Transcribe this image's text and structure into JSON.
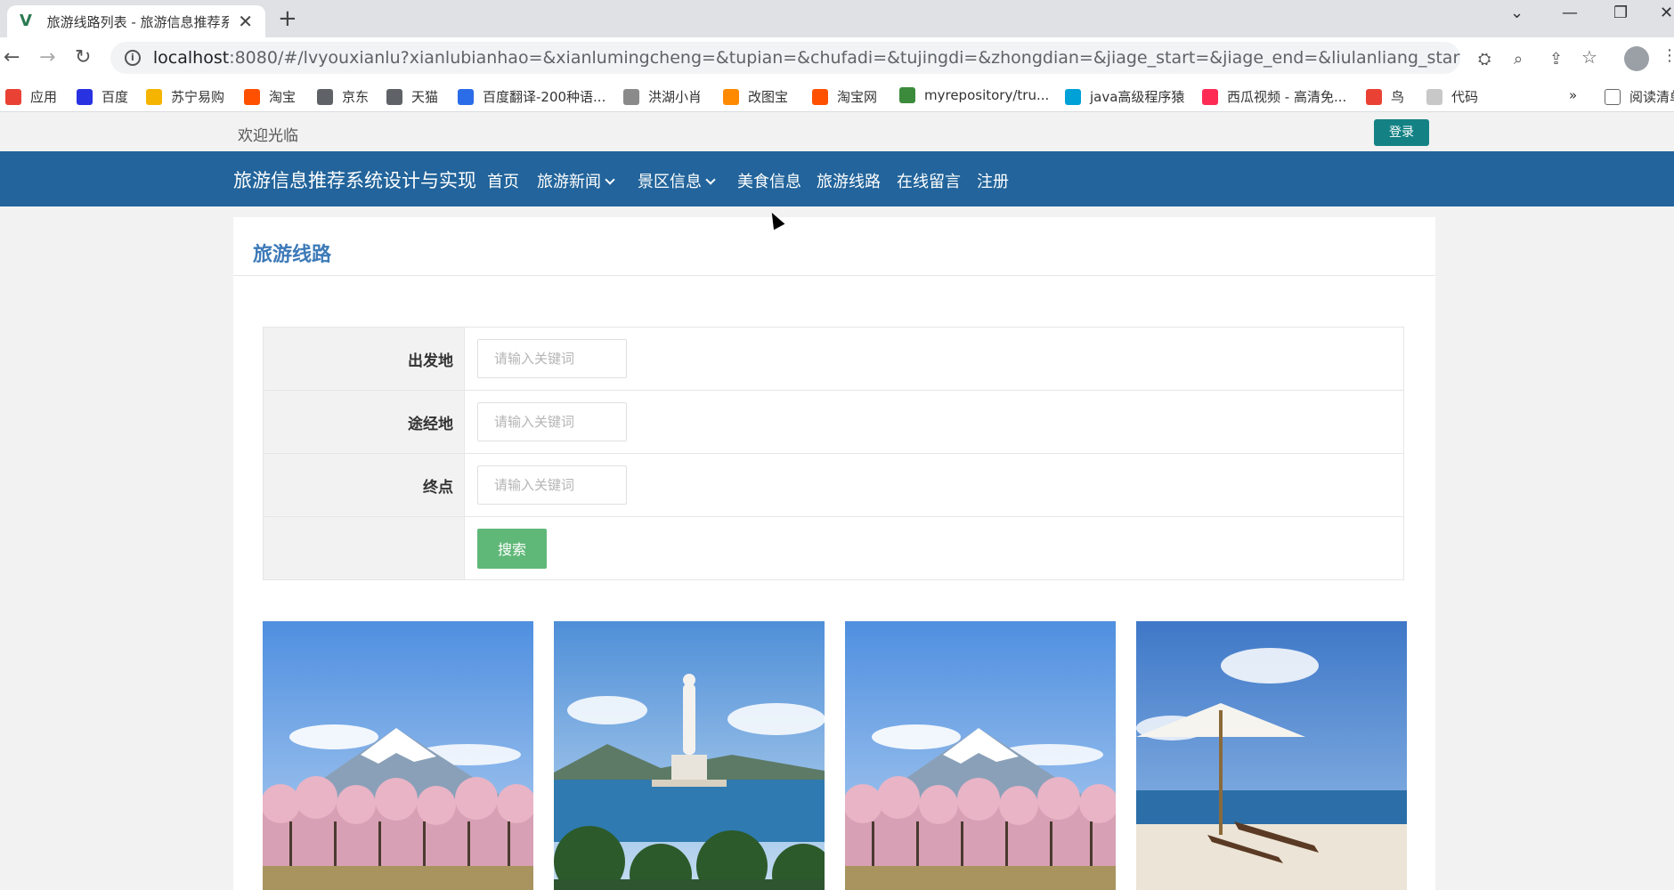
{
  "browser": {
    "tab_title": "旅游线路列表 - 旅游信息推荐系统",
    "tab_favicon": "V",
    "url_host": "localhost",
    "url_rest": ":8080/#/lvyouxianlu?xianlubianhao=&xianlumingcheng=&tupian=&chufadi=&tujingdi=&zhongdian=&jiage_start=&jiage_end=&liulanliang_start=&liulanliang_end...",
    "bookmarks": [
      {
        "label": "应用",
        "color": "#e94235"
      },
      {
        "label": "百度",
        "color": "#2932e1"
      },
      {
        "label": "苏宁易购",
        "color": "#f5b400"
      },
      {
        "label": "淘宝",
        "color": "#ff5000"
      },
      {
        "label": "京东",
        "color": "#5f6368"
      },
      {
        "label": "天猫",
        "color": "#5f6368"
      },
      {
        "label": "百度翻译-200种语...",
        "color": "#2b6de8"
      },
      {
        "label": "洪湖小肖",
        "color": "#8a8a8a"
      },
      {
        "label": "改图宝",
        "color": "#ff8a00"
      },
      {
        "label": "淘宝网",
        "color": "#ff5000"
      },
      {
        "label": "myrepository/tru...",
        "color": "#3c8b3c"
      },
      {
        "label": "java高级程序猿",
        "color": "#00a1d6"
      },
      {
        "label": "西瓜视频 - 高清免...",
        "color": "#fe2c55"
      },
      {
        "label": "鸟",
        "color": "#e94235"
      },
      {
        "label": "代码",
        "color": "#c8c8c8"
      }
    ],
    "bookmarks_overflow": "»",
    "reading_list": "阅读清单"
  },
  "site": {
    "welcome": "欢迎光临",
    "login_label": "登录",
    "brand": "旅游信息推荐系统设计与实现",
    "nav": [
      {
        "label": "首页",
        "dropdown": false
      },
      {
        "label": "旅游新闻",
        "dropdown": true
      },
      {
        "label": "景区信息",
        "dropdown": true
      },
      {
        "label": "美食信息",
        "dropdown": false
      },
      {
        "label": "旅游线路",
        "dropdown": false
      },
      {
        "label": "在线留言",
        "dropdown": false
      },
      {
        "label": "注册",
        "dropdown": false
      }
    ]
  },
  "page": {
    "title": "旅游线路",
    "search": {
      "fields": [
        {
          "label": "出发地",
          "placeholder": "请输入关键词",
          "value": ""
        },
        {
          "label": "途经地",
          "placeholder": "请输入关键词",
          "value": ""
        },
        {
          "label": "终点",
          "placeholder": "请输入关键词",
          "value": ""
        }
      ],
      "button_label": "搜索"
    },
    "thumbnails": [
      {
        "scene": "mount-fuji-cherry-blossoms"
      },
      {
        "scene": "guanyin-statue-sea"
      },
      {
        "scene": "mount-fuji-cherry-blossoms"
      },
      {
        "scene": "beach-umbrella-loungers"
      }
    ]
  },
  "colors": {
    "nav_bg": "#22649b",
    "login_btn": "#148285",
    "search_btn": "#5fb878",
    "title_color": "#3d7ab8"
  }
}
